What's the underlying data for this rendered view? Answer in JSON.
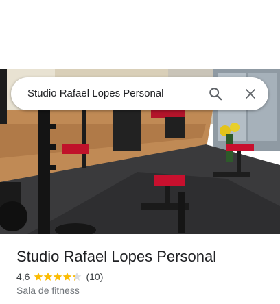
{
  "search": {
    "query": "Studio Rafael Lopes Personal"
  },
  "place": {
    "name": "Studio Rafael Lopes Personal",
    "rating": "4,6",
    "rating_value": 4.6,
    "review_count": "(10)",
    "category": "Sala de fitness"
  },
  "colors": {
    "star": "#fbbc04",
    "star_empty": "#dadce0",
    "title": "#202124",
    "secondary": "#70757a",
    "icon": "#5f6368"
  },
  "icons": {
    "search": "search-icon",
    "close": "close-icon",
    "star": "star-icon"
  }
}
